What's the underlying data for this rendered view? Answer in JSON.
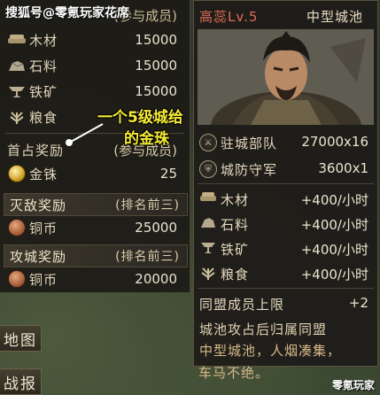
{
  "watermark_top": "搜狐号@零氪玩家花席",
  "watermark_bottom": "零氪玩家",
  "annotation": {
    "line1": "一个5级城给",
    "line2": "的金珠"
  },
  "left_panel": {
    "top_header_fragment": "(参与成员)",
    "resources": [
      {
        "icon": "wood-icon",
        "label": "木材",
        "value": "15000"
      },
      {
        "icon": "stone-icon",
        "label": "石料",
        "value": "15000"
      },
      {
        "icon": "iron-icon",
        "label": "铁矿",
        "value": "15000"
      },
      {
        "icon": "grain-icon",
        "label": "粮食",
        "value": "15000"
      }
    ],
    "first_occupy": {
      "title": "首占奖励",
      "subtitle": "(参与成员)",
      "item_label": "金铢",
      "item_value": "25"
    },
    "destroy_reward": {
      "title": "灭敌奖励",
      "subtitle": "(排名前三)",
      "item_label": "铜币",
      "item_value": "25000"
    },
    "siege_reward": {
      "title": "攻城奖励",
      "subtitle": "(排名前三)",
      "item_label": "铜币",
      "item_value": "20000"
    }
  },
  "right_panel": {
    "lord_name": "高蕊Lv.5",
    "city_type": "中型城池",
    "garrison": {
      "label": "驻城部队",
      "value": "27000x16"
    },
    "defense": {
      "label": "城防守军",
      "value": "3600x1"
    },
    "production": [
      {
        "icon": "wood-icon",
        "label": "木材",
        "value": "+400/小时"
      },
      {
        "icon": "stone-icon",
        "label": "石料",
        "value": "+400/小时"
      },
      {
        "icon": "iron-icon",
        "label": "铁矿",
        "value": "+400/小时"
      },
      {
        "icon": "grain-icon",
        "label": "粮食",
        "value": "+400/小时"
      }
    ],
    "alliance_cap": {
      "label": "同盟成员上限",
      "value": "+2"
    },
    "note": "城池攻占后归属同盟",
    "description_line1": "中型城池，人烟凑集，",
    "description_line2": "车马不绝。"
  },
  "buttons": {
    "map": "地图",
    "report": "战报"
  }
}
